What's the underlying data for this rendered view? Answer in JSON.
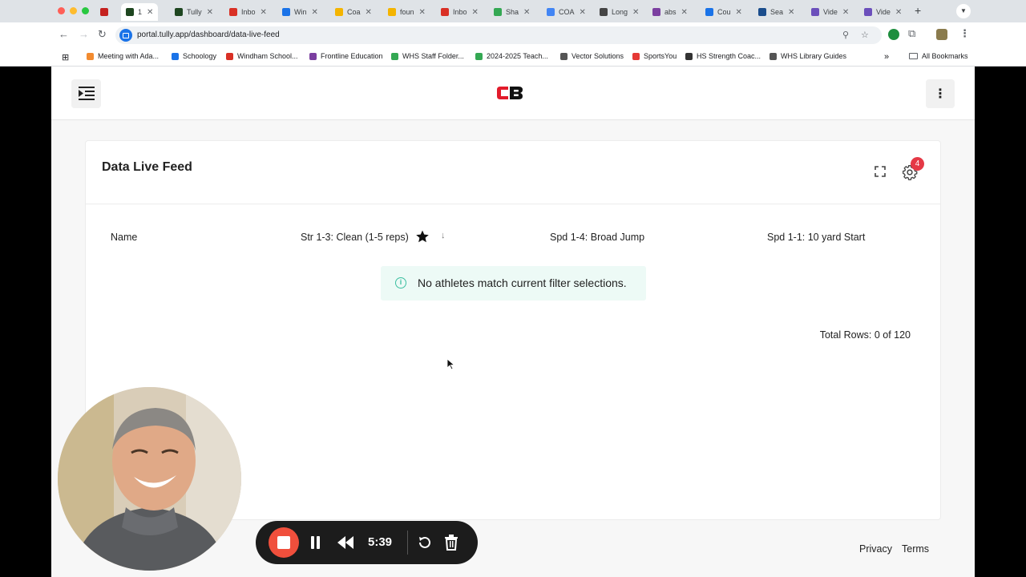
{
  "browser": {
    "tabs": [
      {
        "label": "",
        "icon": "record-icon",
        "color": "#c5221f"
      },
      {
        "label": "1",
        "icon": "tully-icon",
        "color": "#1e4620",
        "active": true
      },
      {
        "label": "Tully",
        "icon": "tully-icon",
        "color": "#1e4620"
      },
      {
        "label": "Inbo",
        "icon": "gmail-icon",
        "color": "#d93025"
      },
      {
        "label": "Win",
        "icon": "schoology-icon",
        "color": "#1a73e8"
      },
      {
        "label": "Coa",
        "icon": "slides-icon",
        "color": "#f4b400"
      },
      {
        "label": "foun",
        "icon": "slides-icon",
        "color": "#f4b400"
      },
      {
        "label": "Inbo",
        "icon": "gmail-icon",
        "color": "#d93025"
      },
      {
        "label": "Sha",
        "icon": "drive-icon",
        "color": "#34a853"
      },
      {
        "label": "COA",
        "icon": "docs-icon",
        "color": "#4285f4"
      },
      {
        "label": "Long",
        "icon": "rsc-icon",
        "color": "#444444"
      },
      {
        "label": "abs",
        "icon": "frontline-icon",
        "color": "#7b3fa0"
      },
      {
        "label": "Cou",
        "icon": "schoology-icon",
        "color": "#1a73e8"
      },
      {
        "label": "Sea",
        "icon": "sis-icon",
        "color": "#1b4d8c"
      },
      {
        "label": "Vide",
        "icon": "video-icon",
        "color": "#6b4fbb"
      },
      {
        "label": "Vide",
        "icon": "video-icon",
        "color": "#6b4fbb"
      }
    ],
    "url": "portal.tully.app/dashboard/data-live-feed",
    "bookmarks": [
      {
        "label": "Meeting with Ada...",
        "color": "#f28b30"
      },
      {
        "label": "Schoology",
        "color": "#1a73e8"
      },
      {
        "label": "Windham School...",
        "color": "#d93025"
      },
      {
        "label": "Frontline Education",
        "color": "#7b3fa0"
      },
      {
        "label": "WHS Staff Folder...",
        "color": "#34a853"
      },
      {
        "label": "2024-2025 Teach...",
        "color": "#34a853"
      },
      {
        "label": "Vector Solutions",
        "color": "#555555"
      },
      {
        "label": "SportsYou",
        "color": "#e53935"
      },
      {
        "label": "HS Strength Coac...",
        "color": "#333333"
      },
      {
        "label": "WHS Library Guides",
        "color": "#555555"
      }
    ],
    "all_bookmarks_label": "All Bookmarks",
    "overflow_label": "»"
  },
  "app": {
    "card_title": "Data Live Feed",
    "settings_badge": "4",
    "columns": [
      "Name",
      "Str 1-3: Clean (1-5 reps)",
      "Spd 1-4: Broad Jump",
      "Spd 1-1: 10 yard Start"
    ],
    "empty_message": "No athletes match current filter selections.",
    "total_rows": "Total Rows: 0 of 120",
    "footer": {
      "privacy": "Privacy",
      "terms": "Terms"
    }
  },
  "recorder": {
    "time": "5:39"
  },
  "colors": {
    "accent_red": "#e53946",
    "record_red": "#f04f3c",
    "info_green": "#3cbfa1",
    "alert_bg": "#edfaf6"
  }
}
